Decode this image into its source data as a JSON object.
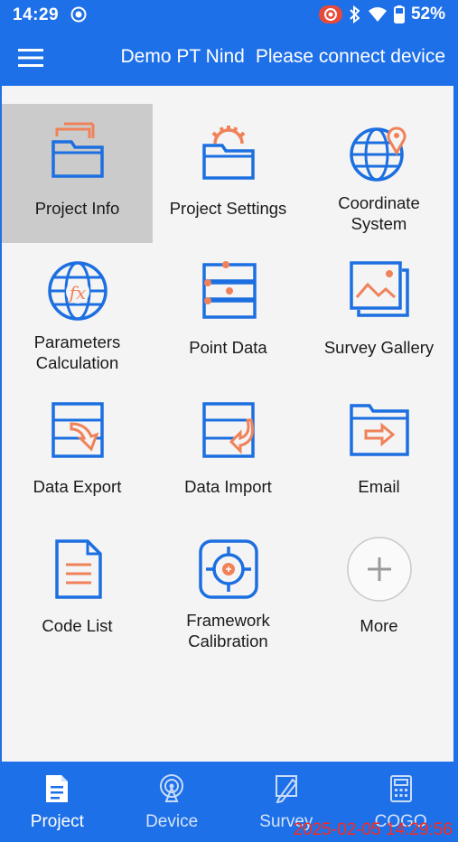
{
  "status_bar": {
    "time": "14:29",
    "battery": "52%"
  },
  "header": {
    "device_name": "Demo PT Nind",
    "connection_status": "Please connect device"
  },
  "grid": [
    {
      "label": "Project Info",
      "icon": "project-info-icon",
      "selected": true
    },
    {
      "label": "Project Settings",
      "icon": "project-settings-icon"
    },
    {
      "label_lines": [
        "Coordinate",
        "System"
      ],
      "icon": "coordinate-system-icon"
    },
    {
      "label_lines": [
        "Parameters",
        "Calculation"
      ],
      "icon": "parameters-calculation-icon"
    },
    {
      "label": "Point Data",
      "icon": "point-data-icon"
    },
    {
      "label": "Survey Gallery",
      "icon": "survey-gallery-icon"
    },
    {
      "label": "Data Export",
      "icon": "data-export-icon"
    },
    {
      "label": "Data Import",
      "icon": "data-import-icon"
    },
    {
      "label": "Email",
      "icon": "email-icon"
    },
    {
      "label": "Code List",
      "icon": "code-list-icon"
    },
    {
      "label_lines": [
        "Framework",
        "Calibration"
      ],
      "icon": "framework-calibration-icon"
    },
    {
      "label": "More",
      "icon": "more-icon"
    }
  ],
  "bottom_nav": [
    {
      "label": "Project",
      "icon": "project-tab-icon",
      "active": true
    },
    {
      "label": "Device",
      "icon": "device-tab-icon"
    },
    {
      "label": "Survey",
      "icon": "survey-tab-icon"
    },
    {
      "label": "COGO",
      "icon": "cogo-tab-icon"
    }
  ],
  "timestamp": "2025-02-05 14:29:56",
  "colors": {
    "primary_blue": "#1e70e8",
    "icon_blue": "#1c6fe0",
    "icon_orange": "#f0825a",
    "selected_bg": "#cbcbcb"
  }
}
